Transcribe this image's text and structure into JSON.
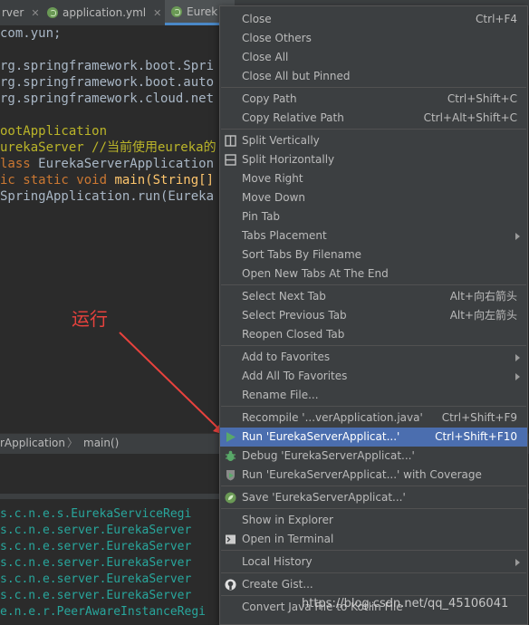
{
  "tabs": [
    {
      "label": "rver",
      "closable": true
    },
    {
      "label": "application.yml",
      "closable": true
    },
    {
      "label": "Eurek",
      "closable": false
    }
  ],
  "code_lines": [
    {
      "prefix": "",
      "text": "com.yun;"
    },
    {
      "prefix": "",
      "text": ""
    },
    {
      "prefix": "",
      "text": "rg.springframework.boot.Spri"
    },
    {
      "prefix": "",
      "text": "rg.springframework.boot.auto"
    },
    {
      "prefix": "",
      "text": "rg.springframework.cloud.net"
    },
    {
      "prefix": "",
      "text": ""
    },
    {
      "prefix": "",
      "text": "ootApplication"
    },
    {
      "prefix": "",
      "text": "urekaServer //当前使用eureka的"
    },
    {
      "prefix": "lass",
      "text": " EurekaServerApplication"
    },
    {
      "prefix": "ic static void",
      "text": " main(String[]"
    },
    {
      "prefix": "",
      "text": "SpringApplication.run(Eureka"
    }
  ],
  "breadcrumb": {
    "item1": "rApplication",
    "sep": "〉",
    "item2": "main()"
  },
  "console_lines": [
    "s.c.n.e.s.EurekaServiceRegi",
    "s.c.n.e.server.EurekaServer",
    "s.c.n.e.server.EurekaServer",
    "s.c.n.e.server.EurekaServer",
    "s.c.n.e.server.EurekaServer",
    "s.c.n.e.server.EurekaServer",
    "e.n.e.r.PeerAwareInstanceRegi"
  ],
  "annotation": {
    "text": "运行",
    "color": "#e8423d"
  },
  "menu": {
    "items": [
      {
        "label": "Close",
        "shortcut": "Ctrl+F4",
        "icon": ""
      },
      {
        "label": "Close Others",
        "shortcut": "",
        "icon": ""
      },
      {
        "label": "Close All",
        "shortcut": "",
        "icon": ""
      },
      {
        "label": "Close All but Pinned",
        "shortcut": "",
        "icon": ""
      },
      {
        "label": "Copy Path",
        "shortcut": "Ctrl+Shift+C",
        "icon": ""
      },
      {
        "label": "Copy Relative Path",
        "shortcut": "Ctrl+Alt+Shift+C",
        "icon": ""
      },
      {
        "label": "Split Vertically",
        "shortcut": "",
        "icon": "split-vertical-icon"
      },
      {
        "label": "Split Horizontally",
        "shortcut": "",
        "icon": "split-horizontal-icon"
      },
      {
        "label": "Move Right",
        "shortcut": "",
        "icon": ""
      },
      {
        "label": "Move Down",
        "shortcut": "",
        "icon": ""
      },
      {
        "label": "Pin Tab",
        "shortcut": "",
        "icon": ""
      },
      {
        "label": "Tabs Placement",
        "shortcut": "",
        "icon": "",
        "submenu": true
      },
      {
        "label": "Sort Tabs By Filename",
        "shortcut": "",
        "icon": ""
      },
      {
        "label": "Open New Tabs At The End",
        "shortcut": "",
        "icon": ""
      },
      {
        "label": "Select Next Tab",
        "shortcut": "Alt+向右箭头",
        "icon": ""
      },
      {
        "label": "Select Previous Tab",
        "shortcut": "Alt+向左箭头",
        "icon": ""
      },
      {
        "label": "Reopen Closed Tab",
        "shortcut": "",
        "icon": ""
      },
      {
        "label": "Add to Favorites",
        "shortcut": "",
        "icon": "",
        "submenu": true
      },
      {
        "label": "Add All To Favorites",
        "shortcut": "",
        "icon": "",
        "submenu": true
      },
      {
        "label": "Rename File...",
        "shortcut": "",
        "icon": ""
      },
      {
        "label": "Recompile '...verApplication.java'",
        "shortcut": "Ctrl+Shift+F9",
        "icon": ""
      },
      {
        "label": "Run 'EurekaServerApplicat...'",
        "shortcut": "Ctrl+Shift+F10",
        "icon": "run-icon",
        "selected": true
      },
      {
        "label": "Debug 'EurekaServerApplicat...'",
        "shortcut": "",
        "icon": "debug-icon"
      },
      {
        "label": "Run 'EurekaServerApplicat...' with Coverage",
        "shortcut": "",
        "icon": "coverage-icon"
      },
      {
        "label": "Save 'EurekaServerApplicat...'",
        "shortcut": "",
        "icon": "spring-icon"
      },
      {
        "label": "Show in Explorer",
        "shortcut": "",
        "icon": ""
      },
      {
        "label": "Open in Terminal",
        "shortcut": "",
        "icon": "terminal-icon"
      },
      {
        "label": "Local History",
        "shortcut": "",
        "icon": "",
        "submenu": true
      },
      {
        "label": "Create Gist...",
        "shortcut": "",
        "icon": "github-icon"
      },
      {
        "label": "Convert Java File to Kotlin File",
        "shortcut": "",
        "icon": ""
      }
    ]
  },
  "watermark": "https://blog.csdn.net/qq_45106041"
}
